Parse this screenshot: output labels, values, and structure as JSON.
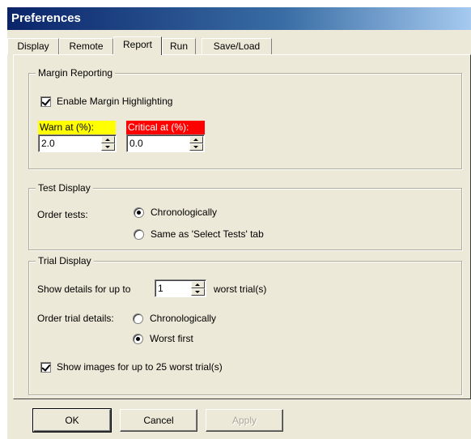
{
  "window": {
    "title": "Preferences"
  },
  "tabs": [
    {
      "label": "Display"
    },
    {
      "label": "Remote"
    },
    {
      "label": "Report",
      "active": true
    },
    {
      "label": "Run"
    },
    {
      "label": "Save/Load"
    }
  ],
  "margin_reporting": {
    "legend": "Margin Reporting",
    "enable_highlighting": {
      "label": "Enable Margin Highlighting",
      "checked": true
    },
    "warn": {
      "label": "Warn at (%):",
      "value": "2.0",
      "color": "#ffff00"
    },
    "critical": {
      "label": "Critical at (%):",
      "value": "0.0",
      "color": "#ff0000"
    }
  },
  "test_display": {
    "legend": "Test Display",
    "order_label": "Order tests:",
    "options": [
      {
        "label": "Chronologically",
        "selected": true
      },
      {
        "label": "Same as 'Select Tests' tab",
        "selected": false
      }
    ]
  },
  "trial_display": {
    "legend": "Trial Display",
    "show_details_prefix": "Show details for up to",
    "show_details_value": "1",
    "show_details_suffix": "worst trial(s)",
    "order_label": "Order trial details:",
    "options": [
      {
        "label": "Chronologically",
        "selected": false
      },
      {
        "label": "Worst first",
        "selected": true
      }
    ],
    "show_images": {
      "label": "Show images for up to 25 worst trial(s)",
      "checked": true
    }
  },
  "buttons": {
    "ok": "OK",
    "cancel": "Cancel",
    "apply": "Apply"
  }
}
